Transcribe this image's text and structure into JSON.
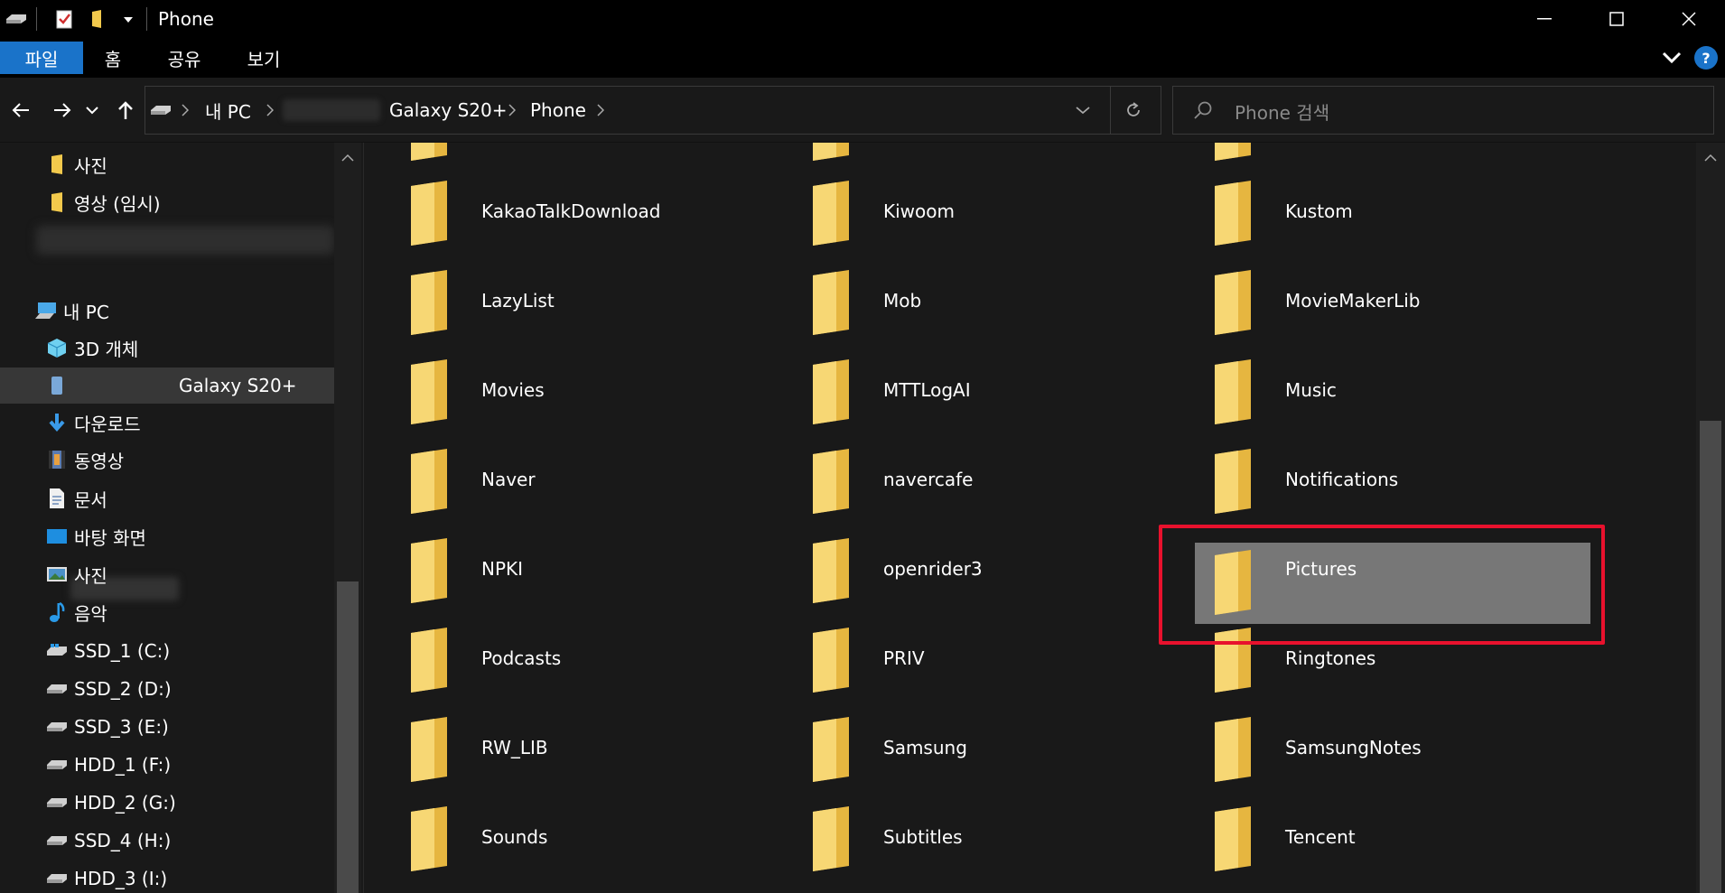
{
  "window": {
    "title": "Phone",
    "controls": {
      "minimize": "minimize-icon",
      "maximize": "maximize-icon",
      "close": "close-icon"
    }
  },
  "ribbon": {
    "tabs": [
      {
        "label": "파일",
        "active": true
      },
      {
        "label": "홈",
        "active": false
      },
      {
        "label": "공유",
        "active": false
      },
      {
        "label": "보기",
        "active": false
      }
    ],
    "help": "?"
  },
  "address": {
    "breadcrumb": [
      "내 PC",
      "Galaxy S20+",
      "Phone"
    ],
    "search_placeholder": "Phone 검색"
  },
  "navpane": {
    "items": [
      {
        "label": "사진",
        "icon": "folder-icon"
      },
      {
        "label": "영상 (임시)",
        "icon": "folder-icon"
      },
      {
        "label": "내 PC",
        "icon": "pc-icon"
      },
      {
        "label": "3D 개체",
        "icon": "cube-icon"
      },
      {
        "label": "Galaxy S20+",
        "icon": "phone-icon"
      },
      {
        "label": "다운로드",
        "icon": "download-icon"
      },
      {
        "label": "동영상",
        "icon": "video-icon"
      },
      {
        "label": "문서",
        "icon": "document-icon"
      },
      {
        "label": "바탕 화면",
        "icon": "desktop-icon"
      },
      {
        "label": "사진",
        "icon": "picture-icon"
      },
      {
        "label": "음악",
        "icon": "music-icon"
      },
      {
        "label": "SSD_1 (C:)",
        "icon": "windows-drive-icon"
      },
      {
        "label": "SSD_2 (D:)",
        "icon": "drive-icon"
      },
      {
        "label": "SSD_3 (E:)",
        "icon": "drive-icon"
      },
      {
        "label": "HDD_1 (F:)",
        "icon": "drive-icon"
      },
      {
        "label": "HDD_2 (G:)",
        "icon": "drive-icon"
      },
      {
        "label": "SSD_4 (H:)",
        "icon": "drive-icon"
      },
      {
        "label": "HDD_3 (I:)",
        "icon": "drive-icon"
      }
    ]
  },
  "folders": [
    "KakaoTalkDownload",
    "Kiwoom",
    "Kustom",
    "LazyList",
    "Mob",
    "MovieMakerLib",
    "Movies",
    "MTTLogAI",
    "Music",
    "Naver",
    "navercafe",
    "Notifications",
    "NPKI",
    "openrider3",
    "Pictures",
    "Podcasts",
    "PRIV",
    "Ringtones",
    "RW_LIB",
    "Samsung",
    "SamsungNotes",
    "Sounds",
    "Subtitles",
    "Tencent"
  ],
  "selected_folder": "Pictures",
  "colors": {
    "accent": "#1a73c9",
    "highlight_box": "#e8112d",
    "selected_tile": "#777777",
    "folder": "#f2c94c"
  }
}
